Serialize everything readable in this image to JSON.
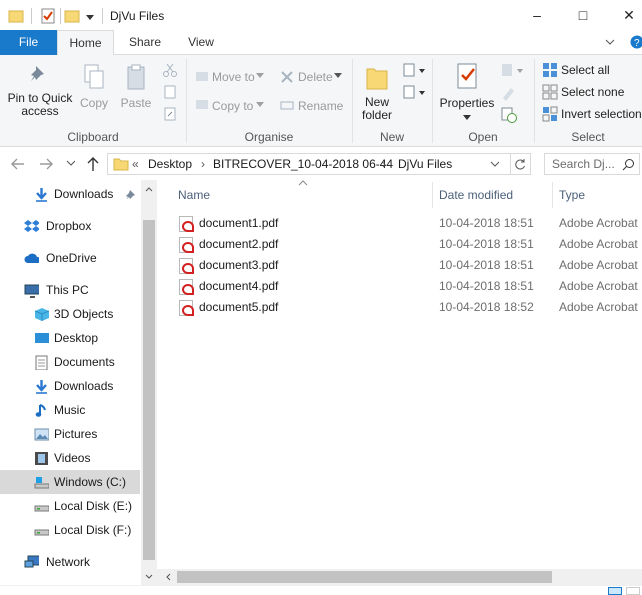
{
  "window": {
    "title": "DjVu Files",
    "minimize": "–",
    "maximize": "□",
    "close": "✕"
  },
  "ribbon_tabs": [
    {
      "label": "File"
    },
    {
      "label": "Home"
    },
    {
      "label": "Share"
    },
    {
      "label": "View"
    }
  ],
  "clipboard": {
    "pin_label": "Pin to Quick access",
    "copy_label": "Copy",
    "paste_label": "Paste",
    "group_label": "Clipboard"
  },
  "organise": {
    "move_to": "Move to",
    "copy_to": "Copy to",
    "delete": "Delete",
    "rename": "Rename",
    "group_label": "Organise"
  },
  "new": {
    "new_folder": "New folder",
    "group_label": "New"
  },
  "open": {
    "properties": "Properties",
    "group_label": "Open"
  },
  "select": {
    "select_all": "Select all",
    "select_none": "Select none",
    "invert_selection": "Invert selection",
    "group_label": "Select"
  },
  "address": {
    "prefix": "«",
    "crumbs": [
      "Desktop",
      "BITRECOVER_10-04-2018 06-44",
      "DjVu Files"
    ],
    "search_placeholder": "Search Dj..."
  },
  "nav": {
    "items": [
      {
        "label": "Downloads",
        "icon": "download-icon"
      },
      {
        "label": "Dropbox",
        "icon": "dropbox-icon"
      },
      {
        "label": "OneDrive",
        "icon": "cloud-icon"
      },
      {
        "label": "This PC",
        "icon": "computer-icon"
      },
      {
        "label": "3D Objects",
        "icon": "cube-icon"
      },
      {
        "label": "Desktop",
        "icon": "desktop-icon"
      },
      {
        "label": "Documents",
        "icon": "document-icon"
      },
      {
        "label": "Downloads",
        "icon": "download-icon"
      },
      {
        "label": "Music",
        "icon": "music-icon"
      },
      {
        "label": "Pictures",
        "icon": "picture-icon"
      },
      {
        "label": "Videos",
        "icon": "video-icon"
      },
      {
        "label": "Windows (C:)",
        "icon": "drive-icon"
      },
      {
        "label": "Local Disk (E:)",
        "icon": "drive-icon"
      },
      {
        "label": "Local Disk (F:)",
        "icon": "drive-icon"
      },
      {
        "label": "Network",
        "icon": "network-icon"
      }
    ]
  },
  "columns": {
    "name": "Name",
    "date": "Date modified",
    "type": "Type"
  },
  "files": [
    {
      "name": "document1.pdf",
      "date": "10-04-2018 18:51",
      "type": "Adobe Acrobat"
    },
    {
      "name": "document2.pdf",
      "date": "10-04-2018 18:51",
      "type": "Adobe Acrobat"
    },
    {
      "name": "document3.pdf",
      "date": "10-04-2018 18:51",
      "type": "Adobe Acrobat"
    },
    {
      "name": "document4.pdf",
      "date": "10-04-2018 18:51",
      "type": "Adobe Acrobat"
    },
    {
      "name": "document5.pdf",
      "date": "10-04-2018 18:52",
      "type": "Adobe Acrobat"
    }
  ],
  "colors": {
    "accent": "#1979ca",
    "selected": "#cce8ff",
    "folder": "#f8d775"
  }
}
